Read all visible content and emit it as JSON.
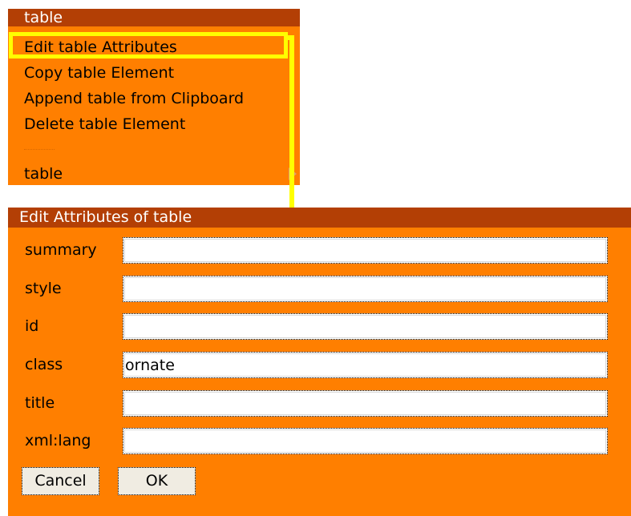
{
  "context_menu": {
    "title": "table",
    "items": [
      {
        "label": "Edit table Attributes"
      },
      {
        "label": "Copy table Element"
      },
      {
        "label": "Append table from Clipboard"
      },
      {
        "label": "Delete table Element"
      }
    ],
    "separator": "------",
    "submenu": {
      "label": "table",
      "icon": "chevron-right-icon"
    }
  },
  "dialog": {
    "title": "Edit Attributes of table",
    "fields": [
      {
        "label": "summary",
        "value": ""
      },
      {
        "label": "style",
        "value": ""
      },
      {
        "label": "id",
        "value": ""
      },
      {
        "label": "class",
        "value": "ornate"
      },
      {
        "label": "title",
        "value": ""
      },
      {
        "label": "xml:lang",
        "value": ""
      }
    ],
    "cancel_label": "Cancel",
    "ok_label": "OK"
  },
  "colors": {
    "menu_bg": "#ff7f00",
    "title_bar": "#b33f05",
    "highlight": "#ffff00"
  }
}
